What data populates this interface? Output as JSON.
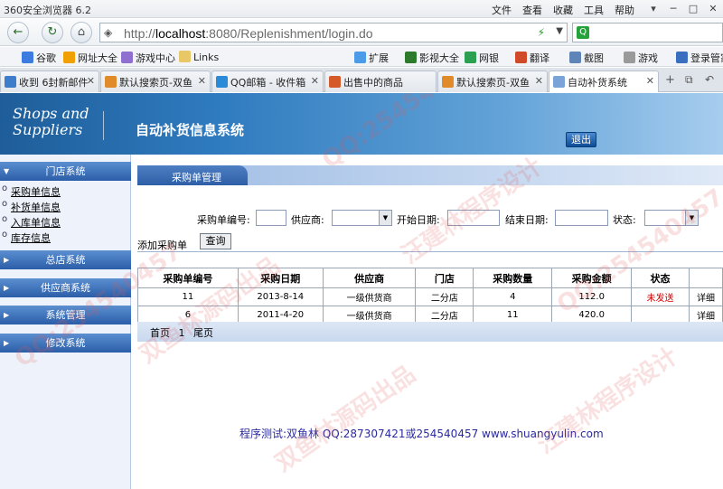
{
  "browser": {
    "app_title": "360安全浏览器 6.2",
    "menu": [
      "文件",
      "查看",
      "收藏",
      "工具",
      "帮助"
    ],
    "window_buttons": [
      "▾",
      "─",
      "□",
      "✕"
    ],
    "address": {
      "prefix": "http://",
      "host": "localhost",
      "rest": ":8080/Replenishment/login.do"
    },
    "search_engine": "Q",
    "favorites": [
      "谷歌",
      "网址大全",
      "游戏中心",
      "Links",
      "扩展",
      "影视大全",
      "网银",
      "翻译",
      "截图",
      "游戏",
      "登录管家"
    ],
    "tabs": [
      "收到 6封新邮件",
      "默认搜索页-双鱼",
      "QQ邮箱 - 收件箱",
      "出售中的商品",
      "默认搜索页-双鱼",
      "自动补货系统"
    ],
    "active_tab_index": 5
  },
  "header": {
    "brand_line1": "Shops and",
    "brand_line2": "Suppliers",
    "system_title": "自动补货信息系统",
    "logout_label": "退出"
  },
  "sidebar": {
    "sections": [
      {
        "title": "门店系统",
        "items": [
          "采购单信息",
          "补货单信息",
          "入库单信息",
          "库存信息"
        ]
      },
      {
        "title": "总店系统",
        "items": []
      },
      {
        "title": "供应商系统",
        "items": []
      },
      {
        "title": "系统管理",
        "items": []
      },
      {
        "title": "修改系统",
        "items": []
      }
    ]
  },
  "panel": {
    "tab_label": "采购单管理",
    "filters": {
      "order_no_label": "采购单编号:",
      "supplier_label": "供应商:",
      "start_date_label": "开始日期:",
      "end_date_label": "结束日期:",
      "status_label": "状态:"
    },
    "add_order_label": "添加采购单",
    "query_label": "查询"
  },
  "table": {
    "headers": [
      "采购单编号",
      "采购日期",
      "供应商",
      "门店",
      "采购数量",
      "采购金额",
      "状态",
      ""
    ],
    "rows": [
      [
        "11",
        "2013-8-14",
        "一级供货商",
        "二分店",
        "4",
        "112.0",
        "未发送",
        "详细"
      ],
      [
        "6",
        "2011-4-20",
        "一级供货商",
        "二分店",
        "11",
        "420.0",
        "",
        "详细"
      ]
    ]
  },
  "pager": {
    "first": "首页",
    "page": "1",
    "last": "尾页"
  },
  "footer": {
    "text": "程序测试:双鱼林 QQ:287307421或254540457 www.shuangyulin.com"
  },
  "watermark": {
    "texts": [
      "QQ:254540457",
      "汪建林程序设计",
      "双鱼林源码出品"
    ]
  },
  "colors": {
    "banner_start": "#1e5d99",
    "sidebar_head": "#2b5ea8",
    "status_red": "#d00000",
    "footer_text": "#2a2aa0"
  }
}
